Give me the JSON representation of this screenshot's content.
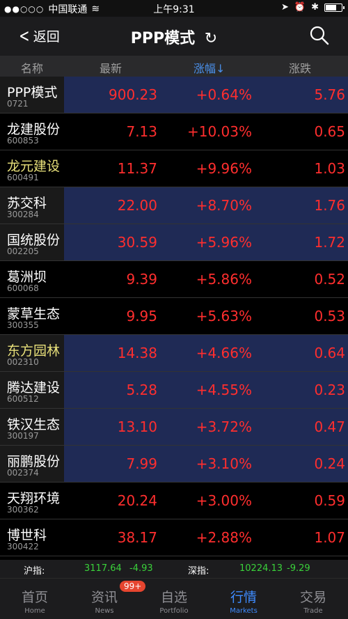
{
  "status": {
    "signal": "●●○○○",
    "carrier": "中国联通",
    "wifi": "≋",
    "time": "上午9:31",
    "location": "➤",
    "alarm": "⏰",
    "bluetooth": "✱",
    "battery_level": 0.72
  },
  "nav": {
    "back_label": "返回",
    "title": "PPP模式",
    "refresh_glyph": "↻"
  },
  "columns": {
    "name": "名称",
    "latest": "最新",
    "pct": "涨幅↓",
    "change": "涨跌"
  },
  "rows": [
    {
      "name": "PPP模式",
      "code": "0721",
      "latest": "900.23",
      "pct": "+0.64%",
      "change": "5.76"
    },
    {
      "name": "龙建股份",
      "code": "600853",
      "latest": "7.13",
      "pct": "+10.03%",
      "change": "0.65"
    },
    {
      "name": "龙元建设",
      "code": "600491",
      "latest": "11.37",
      "pct": "+9.96%",
      "change": "1.03"
    },
    {
      "name": "苏交科",
      "code": "300284",
      "latest": "22.00",
      "pct": "+8.70%",
      "change": "1.76"
    },
    {
      "name": "国统股份",
      "code": "002205",
      "latest": "30.59",
      "pct": "+5.96%",
      "change": "1.72"
    },
    {
      "name": "葛洲坝",
      "code": "600068",
      "latest": "9.39",
      "pct": "+5.86%",
      "change": "0.52"
    },
    {
      "name": "蒙草生态",
      "code": "300355",
      "latest": "9.95",
      "pct": "+5.63%",
      "change": "0.53"
    },
    {
      "name": "东方园林",
      "code": "002310",
      "latest": "14.38",
      "pct": "+4.66%",
      "change": "0.64"
    },
    {
      "name": "腾达建设",
      "code": "600512",
      "latest": "5.28",
      "pct": "+4.55%",
      "change": "0.23"
    },
    {
      "name": "铁汉生态",
      "code": "300197",
      "latest": "13.10",
      "pct": "+3.72%",
      "change": "0.47"
    },
    {
      "name": "丽鹏股份",
      "code": "002374",
      "latest": "7.99",
      "pct": "+3.10%",
      "change": "0.24"
    },
    {
      "name": "天翔环境",
      "code": "300362",
      "latest": "20.24",
      "pct": "+3.00%",
      "change": "0.59"
    },
    {
      "name": "博世科",
      "code": "300422",
      "latest": "38.17",
      "pct": "+2.88%",
      "change": "1.07"
    }
  ],
  "index": {
    "sh_label": "沪指:",
    "sh_value": "3117.64",
    "sh_change": "-4.93",
    "sz_label": "深指:",
    "sz_value": "10224.13",
    "sz_change": "-9.29"
  },
  "tabs": [
    {
      "label": "首页",
      "sub": "Home"
    },
    {
      "label": "资讯",
      "sub": "News"
    },
    {
      "label": "自选",
      "sub": "Portfolio"
    },
    {
      "label": "行情",
      "sub": "Markets"
    },
    {
      "label": "交易",
      "sub": "Trade"
    }
  ],
  "news_badge": "99+",
  "colors": {
    "up": "#ff2e2e",
    "down": "#3ad13a",
    "active_tab": "#3e8bff",
    "highlight_row": "#1f2a55"
  }
}
